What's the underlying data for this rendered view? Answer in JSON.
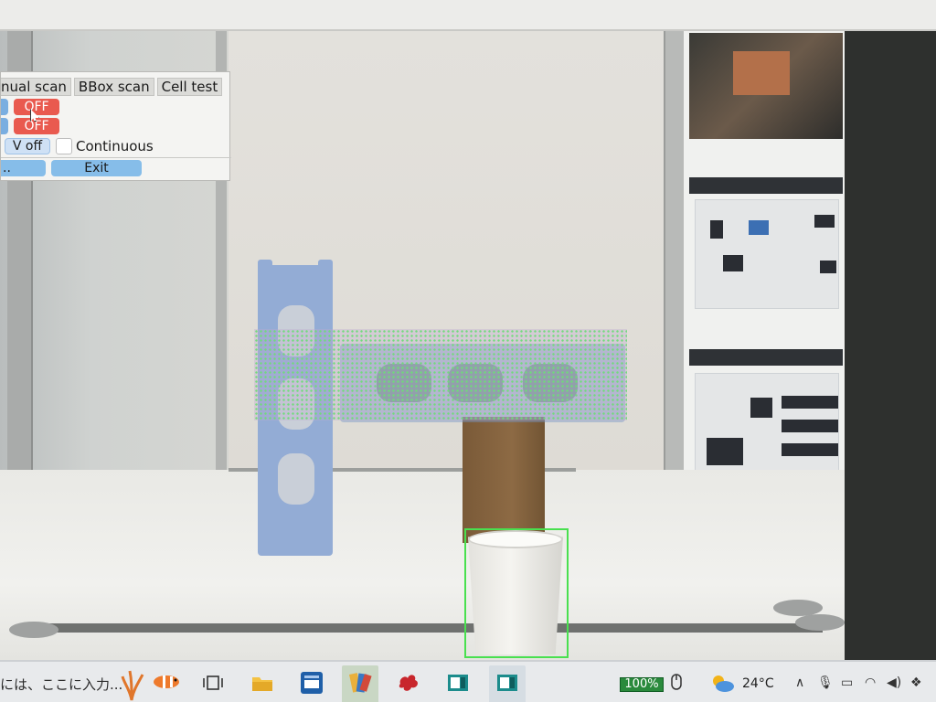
{
  "tool_window": {
    "tabs": [
      "nual scan",
      "BBox scan",
      "Cell test"
    ],
    "toggle_1_label": "OFF",
    "toggle_2_label": "OFF",
    "v_button_label": "V off",
    "continuous_label": "Continuous",
    "continuous_checked": false,
    "left_button_label": "..",
    "exit_label": "Exit"
  },
  "taskbar": {
    "search_text": "には、ここに入力...",
    "battery_label": "100%",
    "temperature": "24°C"
  },
  "icons": {
    "cursor": "mouse-pointer-icon",
    "task_view": "task-view-icon",
    "file_explorer": "folder-icon",
    "teams": "telematic-app-icon",
    "weather": "cloud-sun-icon",
    "chevron": "chevron-up-icon",
    "mic": "microphone-icon",
    "keyboard": "keyboard-icon",
    "wifi": "wifi-icon",
    "volume": "volume-icon",
    "dropbox": "dropbox-icon"
  },
  "colors": {
    "off_red": "#e95a4f",
    "button_blue": "#86bde9",
    "bbox_green": "#49e04f",
    "battery_green": "#2a8a3c"
  }
}
